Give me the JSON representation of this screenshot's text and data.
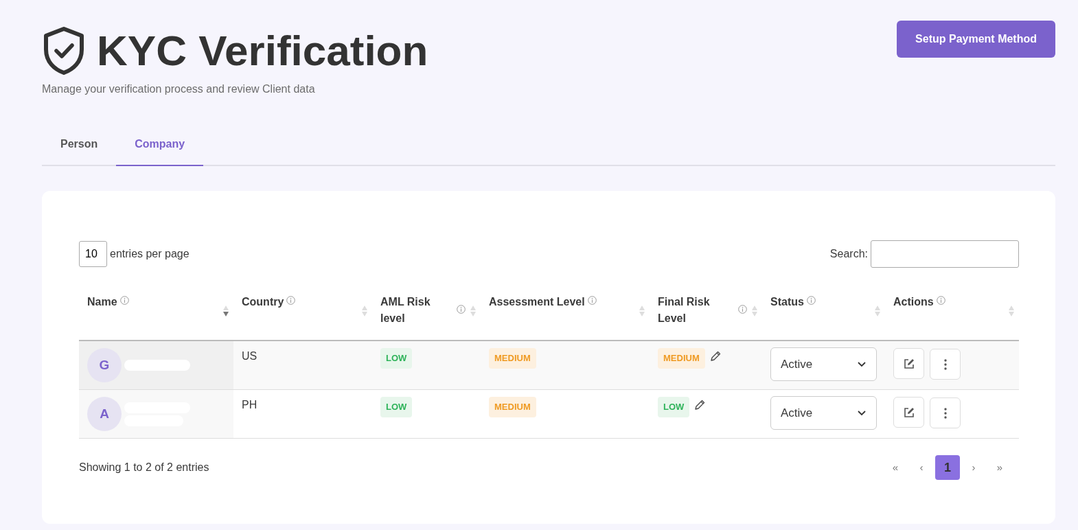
{
  "header": {
    "title": "KYC Verification",
    "subtitle": "Manage your verification process and review Client data",
    "action_button": "Setup Payment Method"
  },
  "tabs": [
    {
      "label": "Person",
      "selected": false
    },
    {
      "label": "Company",
      "selected": true
    }
  ],
  "table_controls": {
    "page_size": "10",
    "page_size_label": "entries per page",
    "search_label": "Search:"
  },
  "table": {
    "columns": [
      {
        "label": "Name",
        "sorted": true
      },
      {
        "label": "Country",
        "sorted": false
      },
      {
        "label": "AML Risk level",
        "sorted": false
      },
      {
        "label": "Assessment Level",
        "sorted": false
      },
      {
        "label": "Final Risk Level",
        "sorted": false
      },
      {
        "label": "Status",
        "sorted": false
      },
      {
        "label": "Actions",
        "sorted": false
      }
    ],
    "rows": [
      {
        "initial": "G",
        "name_parts": [
          {
            "kind": "redaction"
          }
        ],
        "country": "US",
        "aml_risk": {
          "kind": "low",
          "label": "LOW"
        },
        "assessment": {
          "kind": "medium",
          "label": "MEDIUM"
        },
        "final_risk": {
          "kind": "medium",
          "label": "MEDIUM"
        },
        "status": "Active"
      },
      {
        "initial": "A",
        "name_parts": [
          {
            "kind": "redaction"
          },
          {
            "kind": "redaction"
          }
        ],
        "country": "PH",
        "aml_risk": {
          "kind": "low",
          "label": "LOW"
        },
        "assessment": {
          "kind": "medium",
          "label": "MEDIUM"
        },
        "final_risk": {
          "kind": "low",
          "label": "LOW"
        },
        "status": "Active"
      }
    ]
  },
  "footer": {
    "summary": "Showing 1 to 2 of 2 entries",
    "pagination": [
      {
        "label": "«",
        "selected": false
      },
      {
        "label": "‹",
        "selected": false
      },
      {
        "label": "1",
        "selected": true
      },
      {
        "label": "›",
        "selected": false
      },
      {
        "label": "»",
        "selected": false
      }
    ]
  }
}
